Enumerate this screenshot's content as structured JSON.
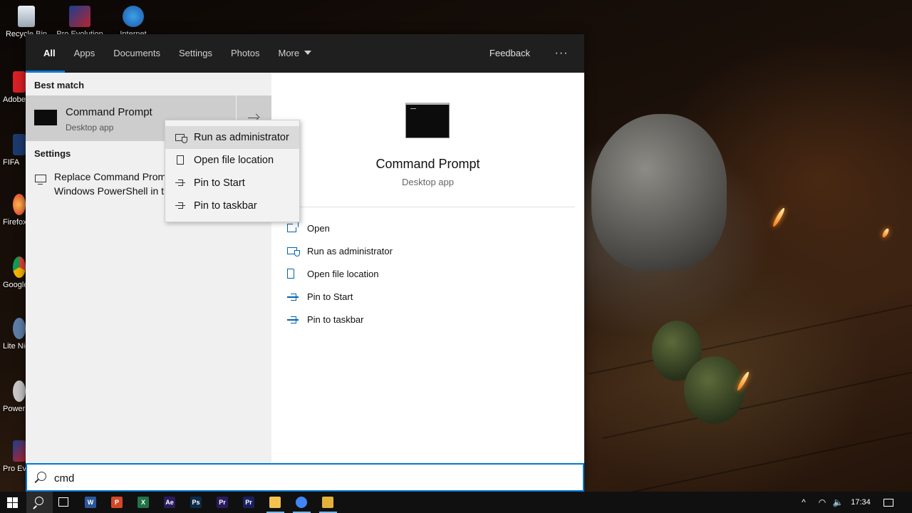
{
  "desktop": {
    "top_icons": [
      {
        "label": "Recycle Bin",
        "icon": "recycle-bin-icon"
      },
      {
        "label": "Pro Evolution",
        "icon": "game-shortcut-icon"
      },
      {
        "label": "Internet",
        "icon": "internet-download-manager-icon"
      }
    ],
    "left_icons": [
      {
        "label": "Adobe Creative",
        "icon": "adobe-cc-icon"
      },
      {
        "label": "FIFA",
        "icon": "fifa-icon"
      },
      {
        "label": "Firefox",
        "icon": "firefox-icon"
      },
      {
        "label": "Google Chrome",
        "icon": "chrome-icon"
      },
      {
        "label": "Lite Nightmare",
        "icon": "game-shortcut-icon"
      },
      {
        "label": "Power",
        "icon": "app-shortcut-icon"
      },
      {
        "label": "Pro Evolution Soccer",
        "icon": "game-shortcut-icon"
      }
    ]
  },
  "tabs": {
    "all": "All",
    "apps": "Apps",
    "documents": "Documents",
    "settings": "Settings",
    "photos": "Photos",
    "more": "More",
    "feedback": "Feedback",
    "overflow": "···"
  },
  "results": {
    "best_match_header": "Best match",
    "best_match": {
      "title": "Command Prompt",
      "subtitle": "Desktop app"
    },
    "settings_header": "Settings",
    "settings_item": {
      "line1": "Replace Command Prompt with",
      "line2": "Windows PowerShell in the Win + X menu"
    }
  },
  "context_menu": {
    "items": [
      {
        "label": "Run as administrator",
        "icon": "shield-icon"
      },
      {
        "label": "Open file location",
        "icon": "file-icon"
      },
      {
        "label": "Pin to Start",
        "icon": "pin-icon"
      },
      {
        "label": "Pin to taskbar",
        "icon": "pin-icon"
      }
    ]
  },
  "preview": {
    "title": "Command Prompt",
    "subtitle": "Desktop app",
    "actions": [
      {
        "label": "Open",
        "icon": "open-icon"
      },
      {
        "label": "Run as administrator",
        "icon": "shield-icon"
      },
      {
        "label": "Open file location",
        "icon": "file-icon"
      },
      {
        "label": "Pin to Start",
        "icon": "pin-icon"
      },
      {
        "label": "Pin to taskbar",
        "icon": "pin-icon"
      }
    ]
  },
  "search": {
    "value": "cmd"
  },
  "taskbar": {
    "apps": [
      {
        "glyph": "W",
        "icon": "word-icon",
        "color": "#2b579a"
      },
      {
        "glyph": "P",
        "icon": "powerpoint-icon",
        "color": "#d24726"
      },
      {
        "glyph": "X",
        "icon": "excel-icon",
        "color": "#217346"
      },
      {
        "glyph": "Ae",
        "icon": "after-effects-icon",
        "color": "#2a1a5e"
      },
      {
        "glyph": "Ps",
        "icon": "photoshop-icon",
        "color": "#0b2b4a"
      },
      {
        "glyph": "Pr",
        "icon": "premiere-icon",
        "color": "#2a1a5e"
      },
      {
        "glyph": "Pr",
        "icon": "premiere-rush-icon",
        "color": "#1a1f5e"
      },
      {
        "glyph": "",
        "icon": "file-explorer-icon",
        "color": "#f2c14e"
      },
      {
        "glyph": "",
        "icon": "chrome-icon",
        "color": "#4285f4"
      },
      {
        "glyph": "",
        "icon": "app-shortcut-icon",
        "color": "#e2b13c"
      }
    ],
    "tray": {
      "chevron": "^",
      "clock": "17:34"
    }
  },
  "colors": {
    "accent": "#0078d7",
    "tabbar": "#1f1f1f",
    "taskbar": "#101010",
    "action_icon": "#0063b1"
  }
}
